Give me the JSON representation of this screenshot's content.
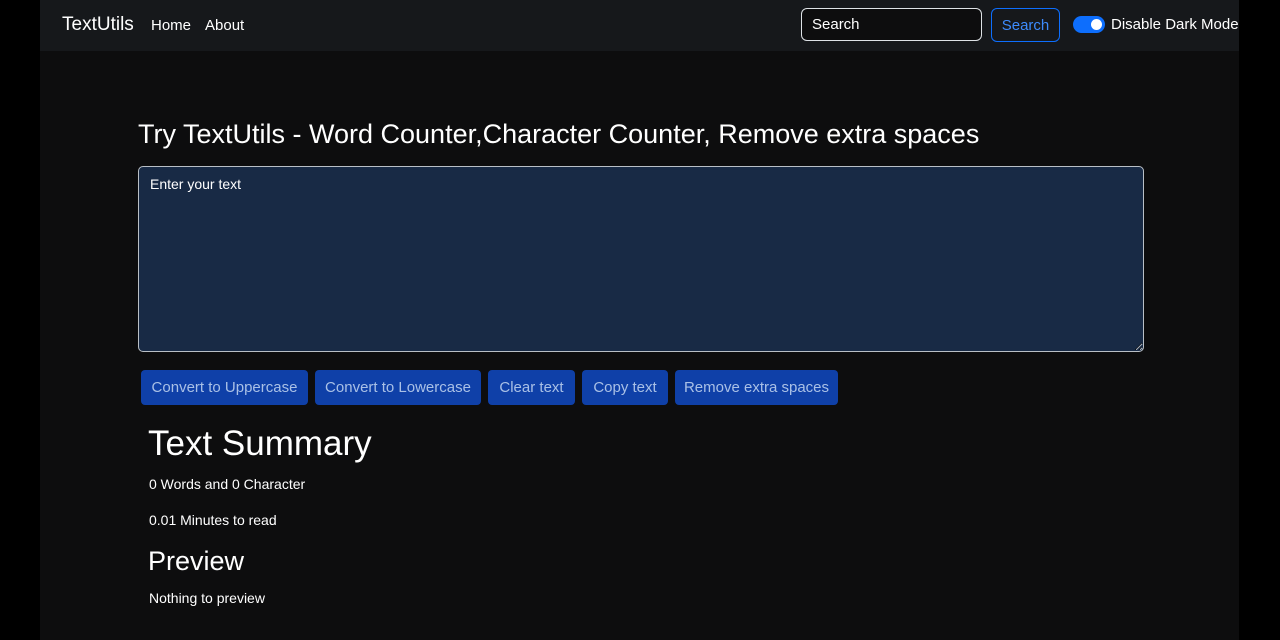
{
  "navbar": {
    "brand": "TextUtils",
    "links": [
      {
        "label": "Home"
      },
      {
        "label": "About"
      }
    ],
    "search": {
      "placeholder": "Search",
      "button_label": "Search"
    },
    "dark_mode_toggle": {
      "label": "Disable Dark Mode",
      "checked": true
    }
  },
  "main": {
    "heading": "Try TextUtils - Word Counter,Character Counter, Remove extra spaces",
    "textarea": {
      "placeholder": "Enter your text",
      "value": ""
    },
    "buttons": [
      {
        "label": "Convert to Uppercase"
      },
      {
        "label": "Convert to Lowercase"
      },
      {
        "label": "Clear text"
      },
      {
        "label": "Copy text"
      },
      {
        "label": "Remove extra spaces"
      }
    ]
  },
  "summary": {
    "title": "Text Summary",
    "count_text": "0 Words and 0 Character",
    "read_time": "0.01 Minutes to read",
    "preview_title": "Preview",
    "preview_text": "Nothing to preview"
  },
  "colors": {
    "page_background": "#0d0d0e",
    "navbar_background": "#16181b",
    "textarea_background": "#182a45",
    "button_background": "#0f40a8",
    "accent": "#0d6efd"
  }
}
